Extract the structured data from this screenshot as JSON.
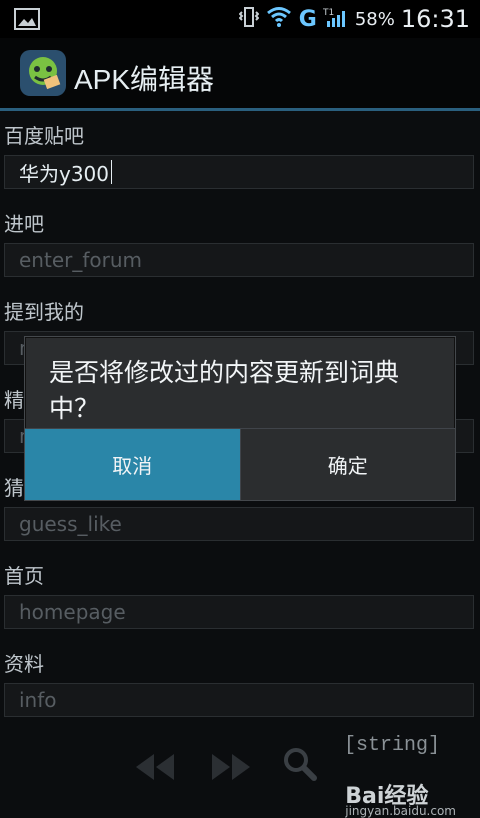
{
  "status_bar": {
    "network_label": "G",
    "battery_percent": "58%",
    "time": "16:31"
  },
  "header": {
    "title": "APK编辑器"
  },
  "form": {
    "fields": [
      {
        "label": "百度贴吧",
        "value": "华为y300",
        "placeholder": ""
      },
      {
        "label": "进吧",
        "value": "",
        "placeholder": "enter_forum"
      },
      {
        "label": "提到我的",
        "value": "",
        "placeholder": "m"
      },
      {
        "label": "精",
        "value": "",
        "placeholder": "m"
      },
      {
        "label": "猜",
        "value": "",
        "placeholder": "guess_like"
      },
      {
        "label": "首页",
        "value": "",
        "placeholder": "homepage"
      },
      {
        "label": "资料",
        "value": "",
        "placeholder": "info"
      }
    ]
  },
  "dialog": {
    "message": "是否将修改过的内容更新到词典中？",
    "cancel_label": "取消",
    "ok_label": "确定"
  },
  "toolbar": {
    "string_tag": "[string]"
  },
  "watermark": {
    "brand": "Bai经验",
    "domain": "jingyan.baidu.com"
  },
  "colors": {
    "accent": "#2a86a8",
    "header_divider": "#2a5f7e"
  }
}
